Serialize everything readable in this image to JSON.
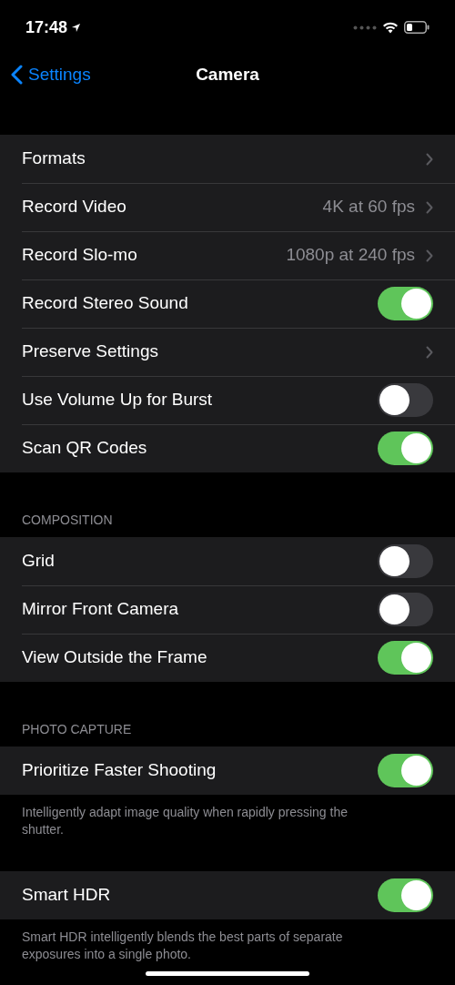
{
  "status_bar": {
    "time": "17:48"
  },
  "nav": {
    "back": "Settings",
    "title": "Camera"
  },
  "sections": [
    {
      "rows": [
        {
          "kind": "link",
          "label": "Formats"
        },
        {
          "kind": "link",
          "label": "Record Video",
          "value": "4K at 60 fps"
        },
        {
          "kind": "link",
          "label": "Record Slo-mo",
          "value": "1080p at 240 fps"
        },
        {
          "kind": "toggle",
          "label": "Record Stereo Sound",
          "on": true
        },
        {
          "kind": "link",
          "label": "Preserve Settings"
        },
        {
          "kind": "toggle",
          "label": "Use Volume Up for Burst",
          "on": false
        },
        {
          "kind": "toggle",
          "label": "Scan QR Codes",
          "on": true
        }
      ]
    },
    {
      "header": "COMPOSITION",
      "rows": [
        {
          "kind": "toggle",
          "label": "Grid",
          "on": false
        },
        {
          "kind": "toggle",
          "label": "Mirror Front Camera",
          "on": false
        },
        {
          "kind": "toggle",
          "label": "View Outside the Frame",
          "on": true
        }
      ]
    },
    {
      "header": "PHOTO CAPTURE",
      "rows": [
        {
          "kind": "toggle",
          "label": "Prioritize Faster Shooting",
          "on": true
        }
      ],
      "footer": "Intelligently adapt image quality when rapidly pressing the shutter."
    },
    {
      "rows": [
        {
          "kind": "toggle",
          "label": "Smart HDR",
          "on": true
        }
      ],
      "footer": "Smart HDR intelligently blends the best parts of separate exposures into a single photo."
    }
  ]
}
